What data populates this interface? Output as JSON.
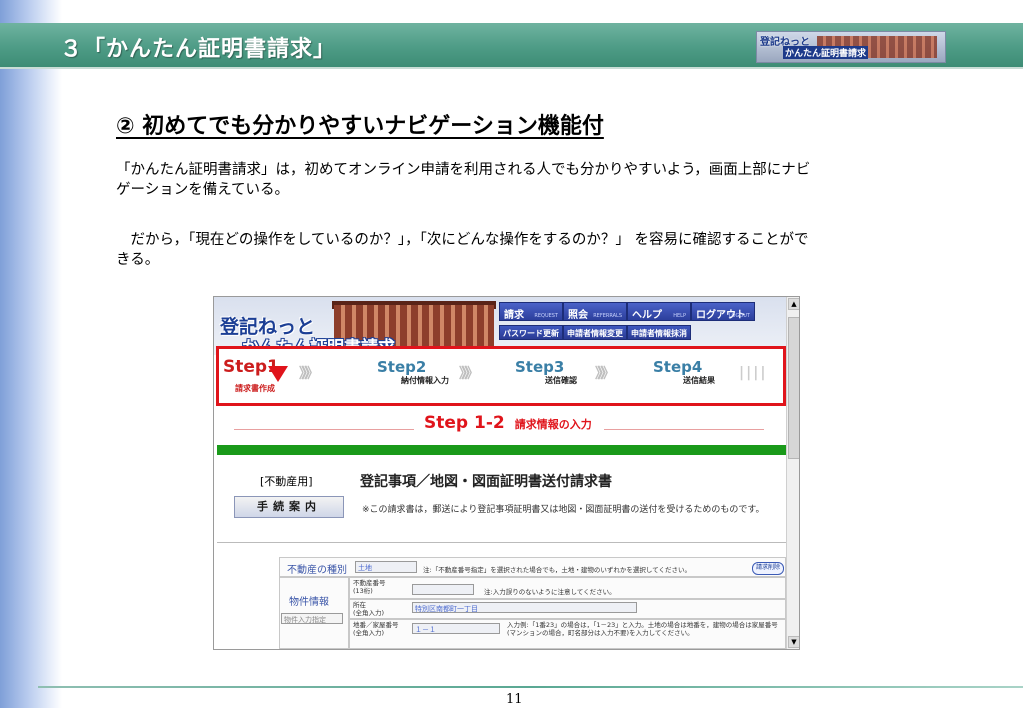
{
  "slide": {
    "header_title": "３「かんたん証明書請求」",
    "logo_text_1": "登記ねっと",
    "logo_text_2": "かんたん証明書請求",
    "subtitle": "②  初めてでも分かりやすいナビゲーション機能付",
    "para1": "「かんたん証明書請求」は，初めてオンライン申請を利用される人でも分かりやすいよう，画面上部にナビゲーションを備えている。",
    "para2": "　だから，「現在どの操作をしているのか？」，「次にどんな操作をするのか？」 を容易に確認することができる。",
    "page_number": "11"
  },
  "screenshot": {
    "logo_line1": "登記ねっと",
    "logo_line2": "かんたん証明書請求",
    "nav": [
      {
        "label": "請求",
        "sub": "REQUEST"
      },
      {
        "label": "照会",
        "sub": "REFERRALS"
      },
      {
        "label": "ヘルプ",
        "sub": "HELP"
      },
      {
        "label": "ログアウト",
        "sub": "LOGOUT"
      }
    ],
    "nav2": [
      "パスワード更新",
      "申請者情報変更",
      "申請者情報抹消"
    ],
    "steps": [
      {
        "name": "Step1",
        "desc": "請求書作成"
      },
      {
        "name": "Step2",
        "desc": "納付情報入力"
      },
      {
        "name": "Step3",
        "desc": "送信確認"
      },
      {
        "name": "Step4",
        "desc": "送信結果"
      }
    ],
    "step_arrow": "》》》",
    "step_end_bars": "||||",
    "step_heading_num": "Step 1-2",
    "step_heading_title": "請求情報の入力",
    "doc_type": "[不動産用]",
    "doc_title": "登記事項／地図・図面証明書送付請求書",
    "guide_button": "手続案内",
    "doc_note": "※この請求書は，郵送により登記事項証明書又は地図・図面証明書の送付を受けるためのものです。",
    "form": {
      "prop_type_label": "不動産の種別",
      "prop_type_value": "土地",
      "prop_type_note": "注:「不動産番号指定」を選択された場合でも，土地・建物のいずれかを選択してください。",
      "clear_button": "請求削除",
      "property_info_label": "物件情報",
      "property_input_method": "物件入力指定",
      "realestate_no_label": "不動産番号\n(13桁)",
      "realestate_no_note": "注:入力誤りのないように注意してください。",
      "location_label": "所在\n(全角入力)",
      "location_value": "特別区南都町一丁目",
      "lot_no_label": "地番／家屋番号\n(全角入力)",
      "lot_no_value": "１－１",
      "lot_no_note": "入力例:「1番23」の場合は，「1－23」と入力。土地の場合は地番を，建物の場合は家屋番号(マンションの場合，町名部分は入力不要)を入力してください。"
    }
  }
}
